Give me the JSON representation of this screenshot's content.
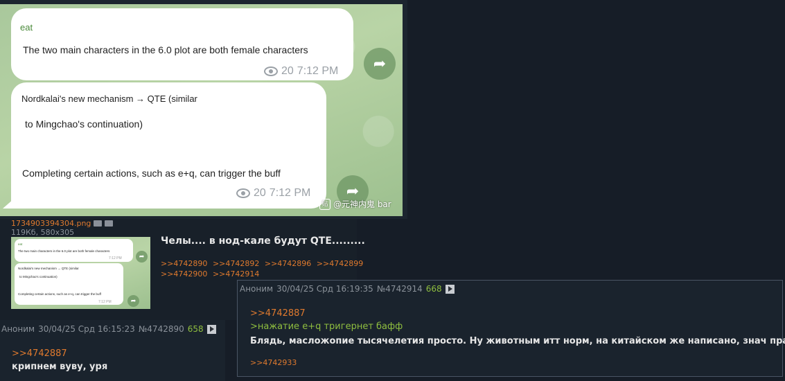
{
  "telegram": {
    "message1": {
      "author": "eat",
      "text": "The two main characters in the 6.0 plot are both female characters",
      "views": "20",
      "time": "7:12 PM"
    },
    "message2": {
      "line1": "Nordkalai's new mechanism → QTE (similar",
      "line2": "to Mingchao's continuation)",
      "line3": "Completing certain actions, such as e+q, can trigger the buff",
      "views": "20",
      "time": "7:12 PM"
    },
    "watermark": "@元神内鬼 bar"
  },
  "op_post": {
    "file_name": "1734903394304.png",
    "file_meta": "119Кб, 580x305",
    "text": "Челы.... в нод-кале будут QTE.........",
    "replies_line1": [
      ">>4742890",
      ">>4742892",
      ">>4742896",
      ">>4742899"
    ],
    "replies_line2": [
      ">>4742900",
      ">>4742914"
    ]
  },
  "post1": {
    "author": "Аноним",
    "date": "30/04/25 Срд 16:15:23",
    "number": "№4742890",
    "count": "658",
    "reply_to": ">>4742887",
    "text": "крипнем вуву, уря"
  },
  "post2": {
    "author": "Аноним",
    "date": "30/04/25 Срд 16:19:35",
    "number": "№4742914",
    "count": "668",
    "reply_to": ">>4742887",
    "quote": ">нажатие е+q тригернет бафф",
    "text": "Блядь, масложопие тысячелетия просто. Ну животным итт норм, на китайском же написано, знач правда.",
    "reply_link": ">>4742933"
  },
  "icons": {
    "share": "share-arrow-icon",
    "views": "eye-icon",
    "play": "play-icon"
  },
  "colors": {
    "background": "#161d27",
    "link_orange": "#e07a2e",
    "greentext": "#8fbe3f",
    "telegram_green": "#a9c89c"
  }
}
